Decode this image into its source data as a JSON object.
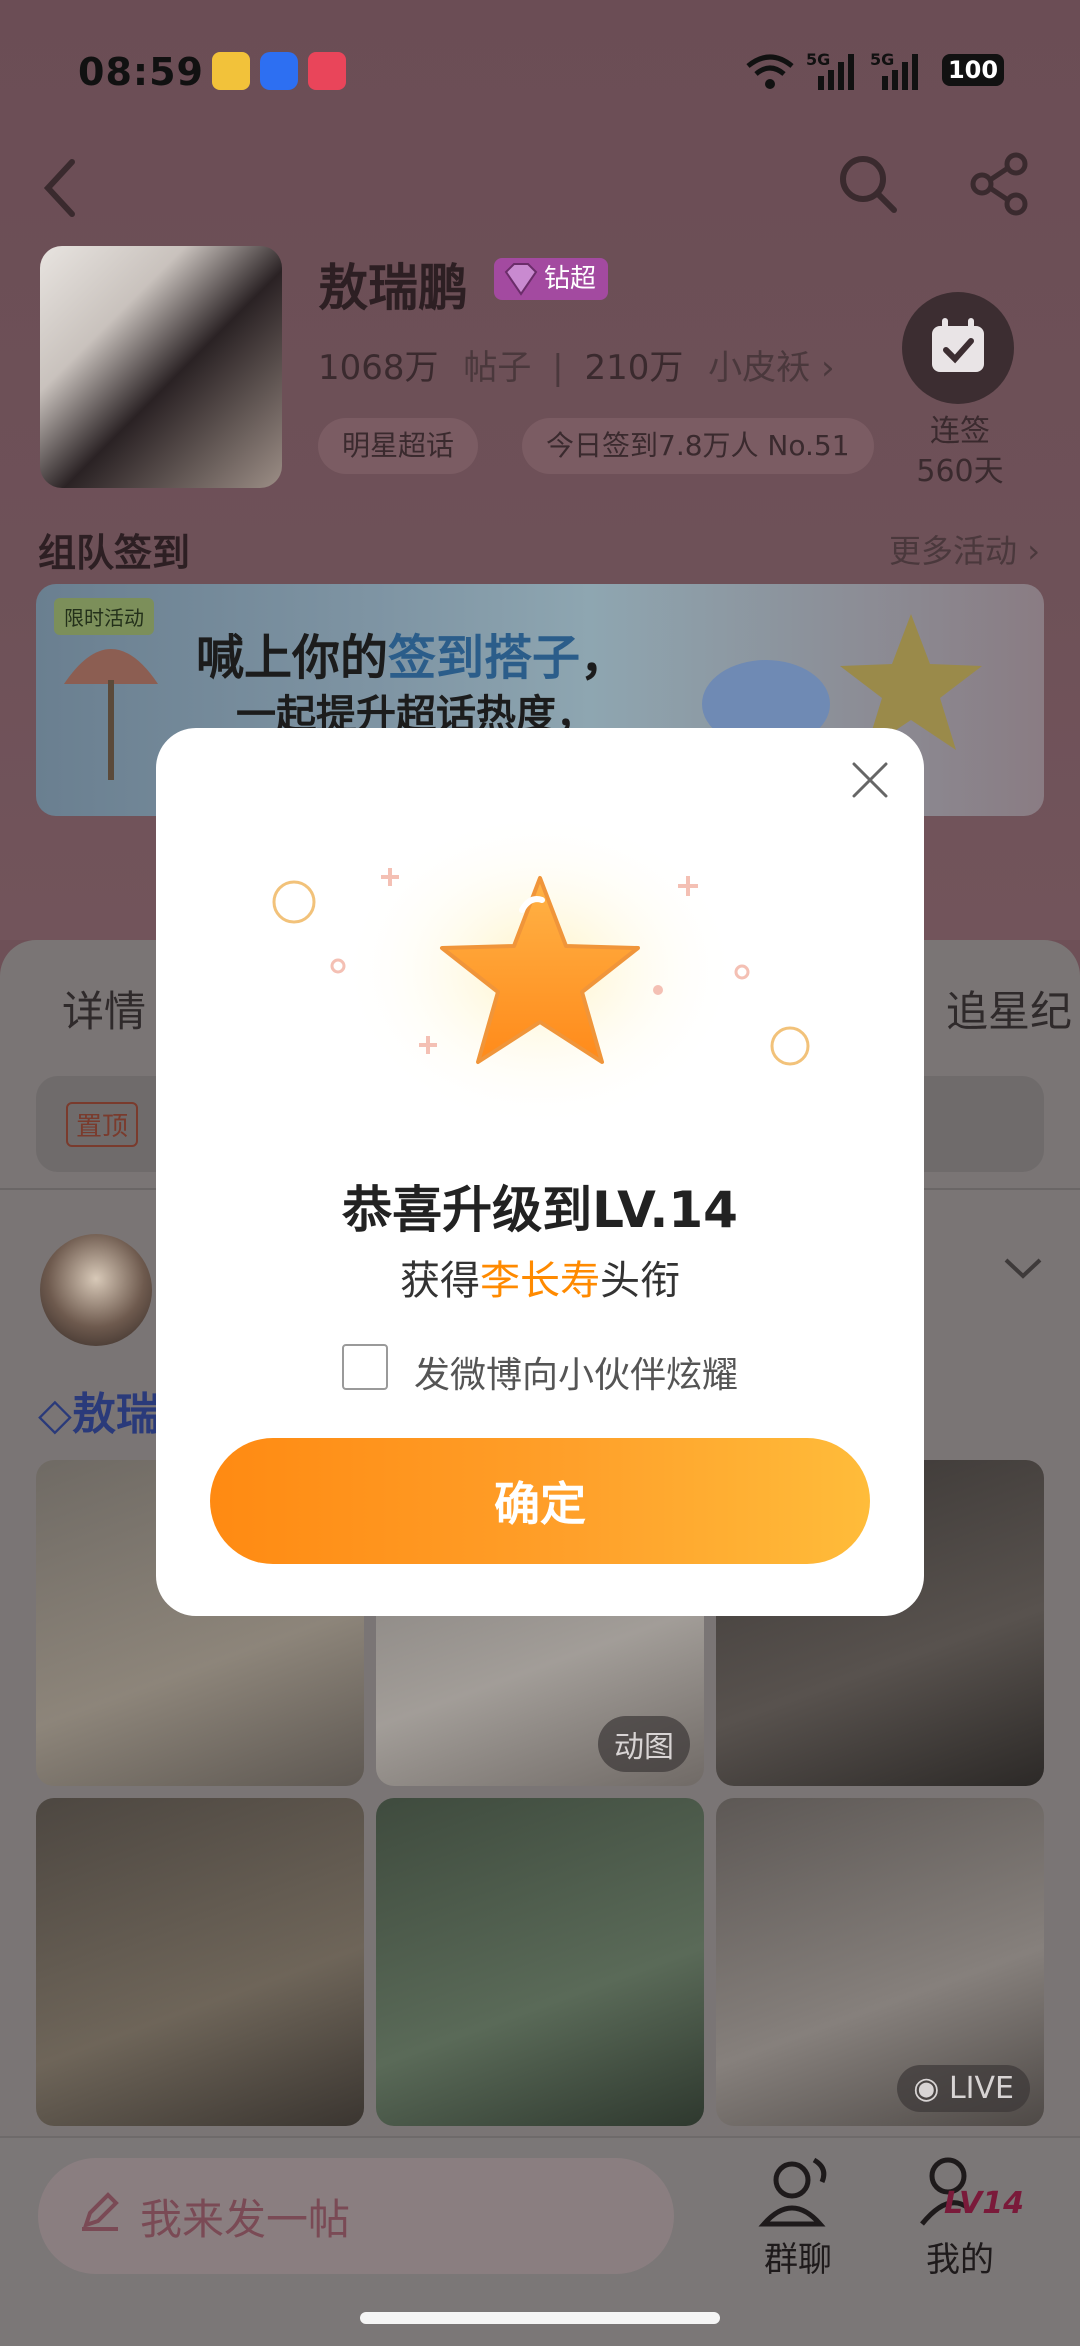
{
  "status_bar": {
    "time": "08:59",
    "battery": "100",
    "signal": "5G"
  },
  "header": {
    "back_icon": "chevron-left-icon",
    "search_icon": "search-icon",
    "share_icon": "share-icon"
  },
  "profile": {
    "name": "敖瑞鹏",
    "badge": "钻超",
    "stats": {
      "posts_count": "1068万",
      "posts_label": "帖子",
      "fans_count": "210万",
      "fans_label": "小皮袄"
    },
    "pills": [
      "明星超话",
      "今日签到7.8万人 No.51"
    ],
    "checkin_label_1": "连签",
    "checkin_label_2": "560天"
  },
  "team_section": {
    "title": "组队签到",
    "more": "更多活动"
  },
  "banner": {
    "tag": "限时活动",
    "line1_prefix": "喊上你的",
    "line1_highlight": "签到搭子",
    "line1_suffix": "，",
    "line2": "一起提升超话热度，"
  },
  "tabs": {
    "left": "详情",
    "right": "追星纪"
  },
  "pinned": {
    "tag": "置顶"
  },
  "post": {
    "author_prefix": "敖瑞"
  },
  "photos": {
    "tag_gif": "动图",
    "tag_live": "LIVE"
  },
  "bottom_bar": {
    "compose_placeholder": "我来发一帖",
    "group_chat": "群聊",
    "mine": "我的",
    "level_badge": "LV14"
  },
  "modal": {
    "title": "恭喜升级到LV.14",
    "sub_prefix": "获得",
    "sub_highlight": "李长寿",
    "sub_suffix": "头衔",
    "checkbox_label": "发微博向小伙伴炫耀",
    "confirm": "确定"
  },
  "colors": {
    "accent_orange": "#ff8a00",
    "badge_purple": "#a34aa0"
  }
}
